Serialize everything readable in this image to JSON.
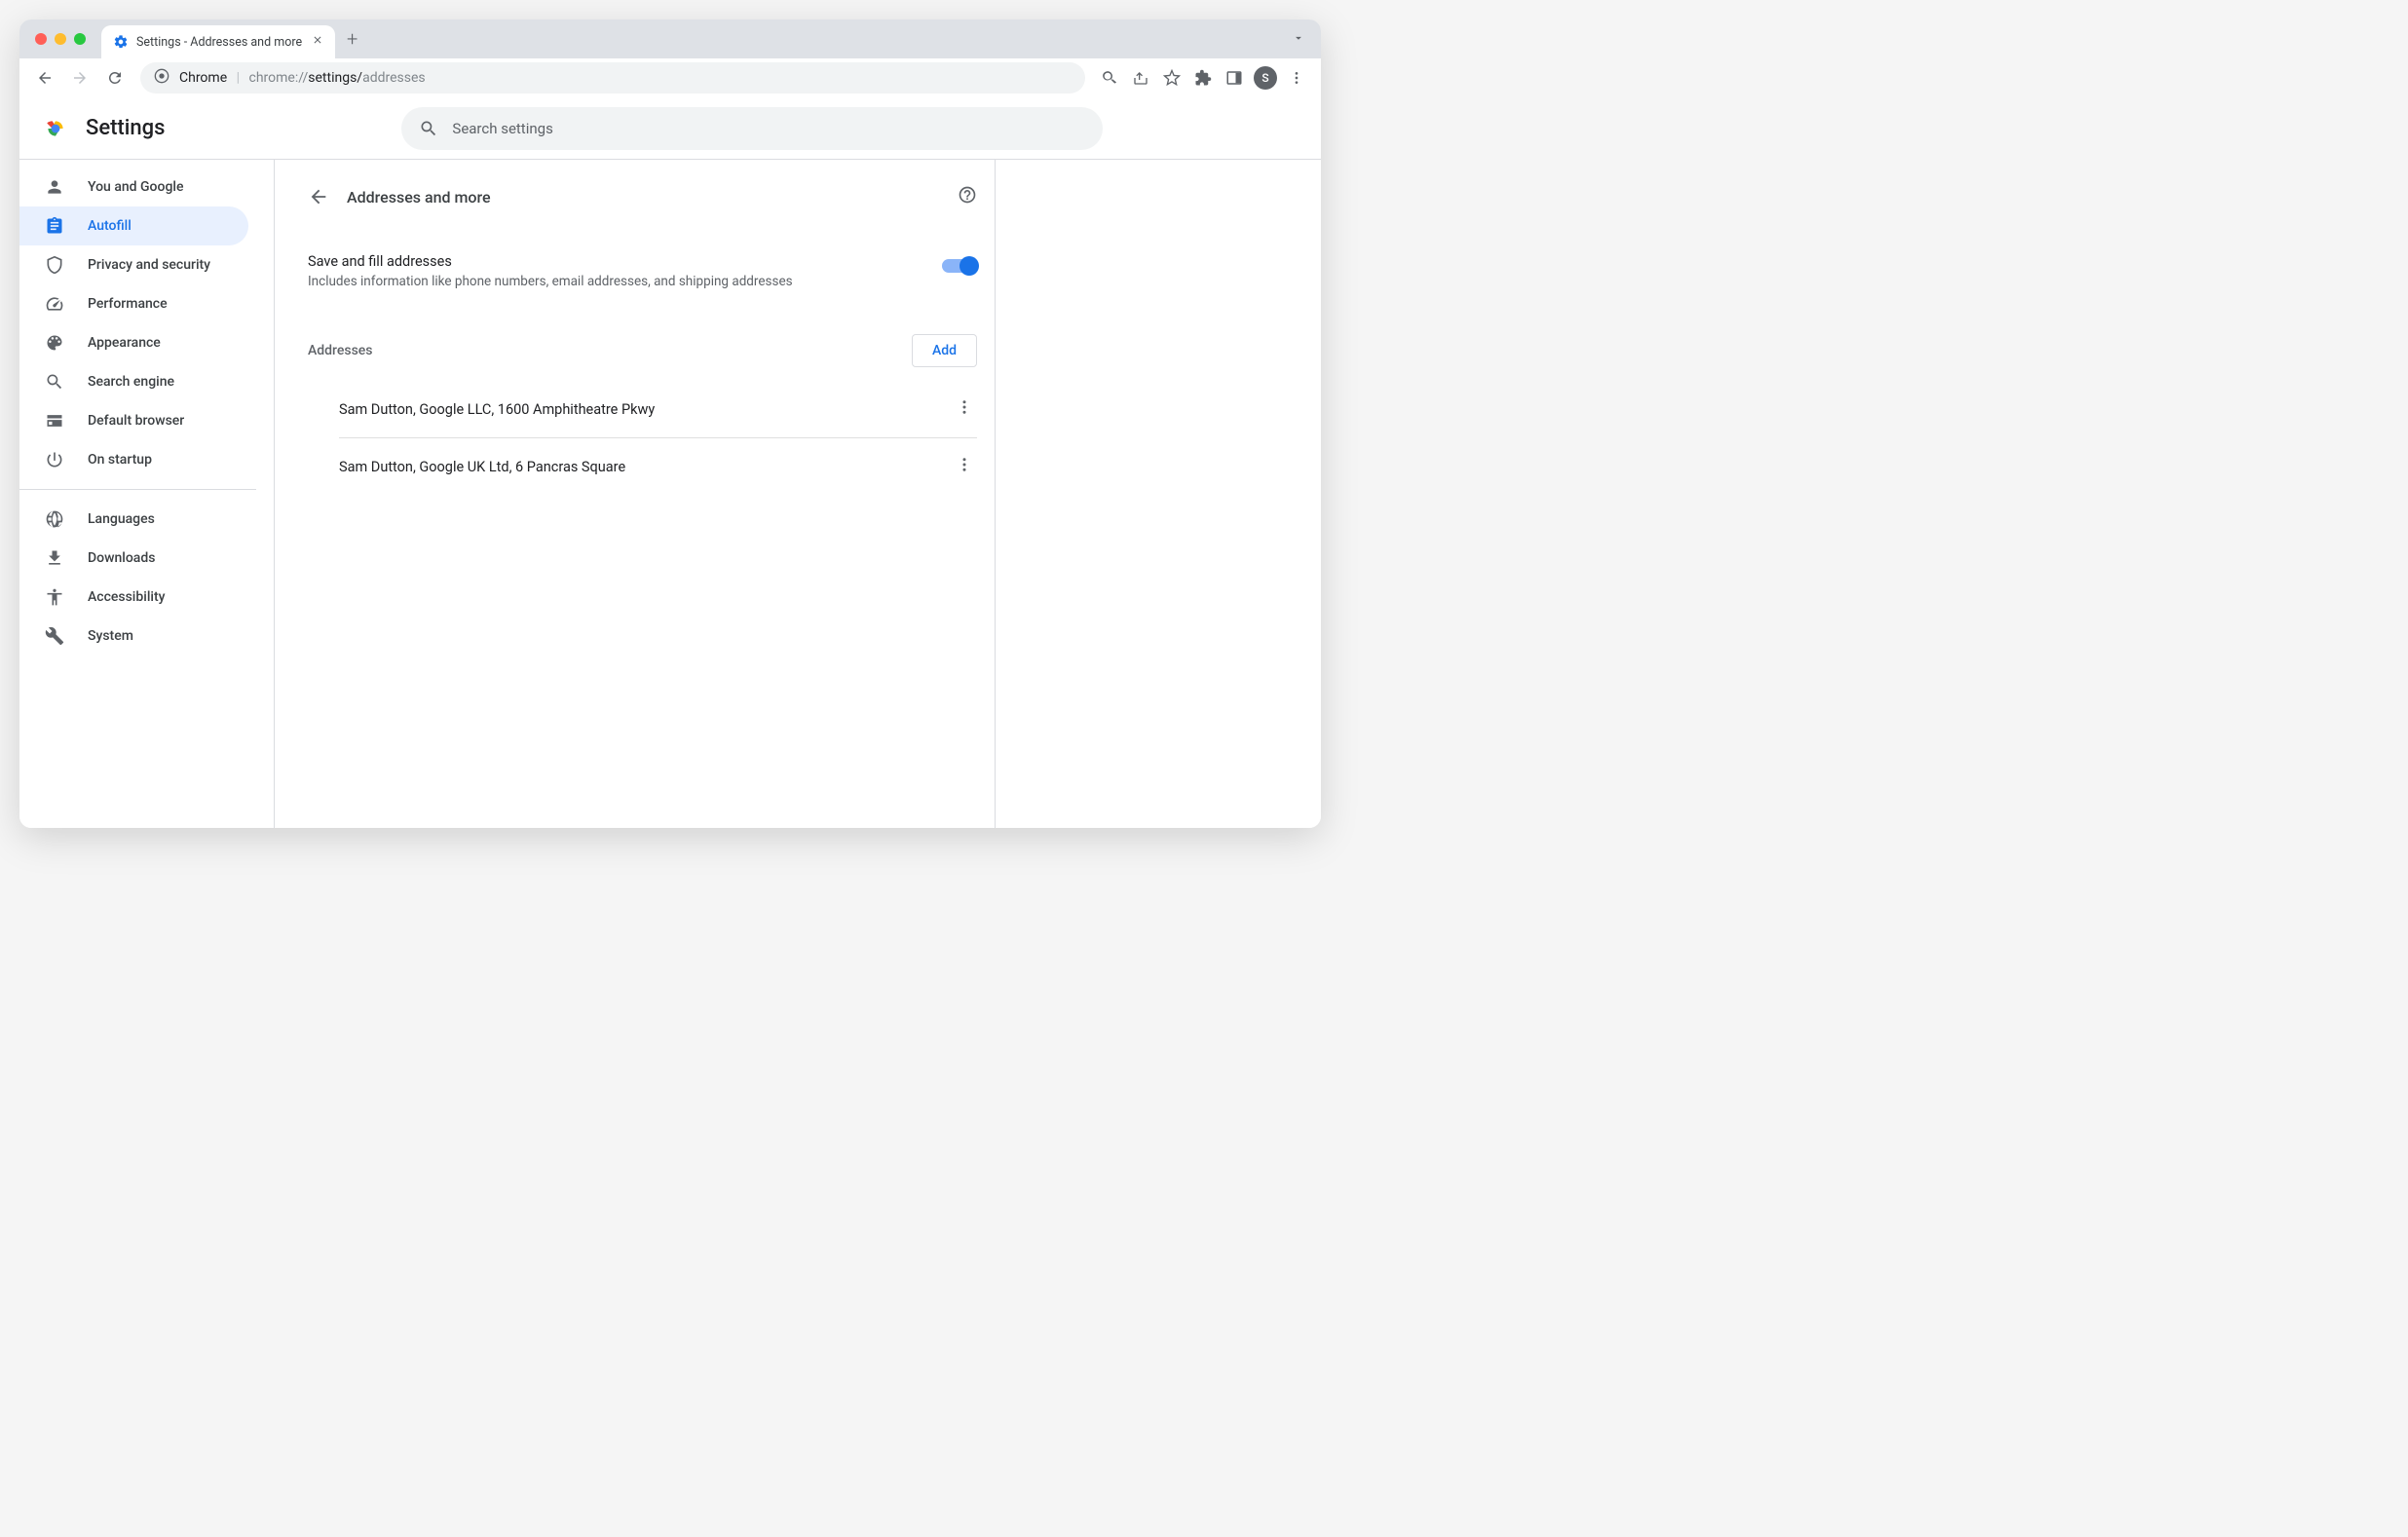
{
  "tab": {
    "title": "Settings - Addresses and more"
  },
  "omnibox": {
    "prefix": "Chrome",
    "scheme": "chrome://",
    "host": "settings/",
    "path": "addresses"
  },
  "avatar_initial": "S",
  "app_title": "Settings",
  "search_placeholder": "Search settings",
  "sidebar": {
    "groups": [
      [
        {
          "label": "You and Google"
        },
        {
          "label": "Autofill"
        },
        {
          "label": "Privacy and security"
        },
        {
          "label": "Performance"
        },
        {
          "label": "Appearance"
        },
        {
          "label": "Search engine"
        },
        {
          "label": "Default browser"
        },
        {
          "label": "On startup"
        }
      ],
      [
        {
          "label": "Languages"
        },
        {
          "label": "Downloads"
        },
        {
          "label": "Accessibility"
        },
        {
          "label": "System"
        }
      ]
    ]
  },
  "panel": {
    "title": "Addresses and more",
    "toggle_title": "Save and fill addresses",
    "toggle_desc": "Includes information like phone numbers, email addresses, and shipping addresses",
    "toggle_on": true,
    "section_label": "Addresses",
    "add_label": "Add",
    "addresses": [
      "Sam Dutton, Google LLC, 1600 Amphitheatre Pkwy",
      "Sam Dutton, Google UK Ltd, 6 Pancras Square"
    ]
  }
}
